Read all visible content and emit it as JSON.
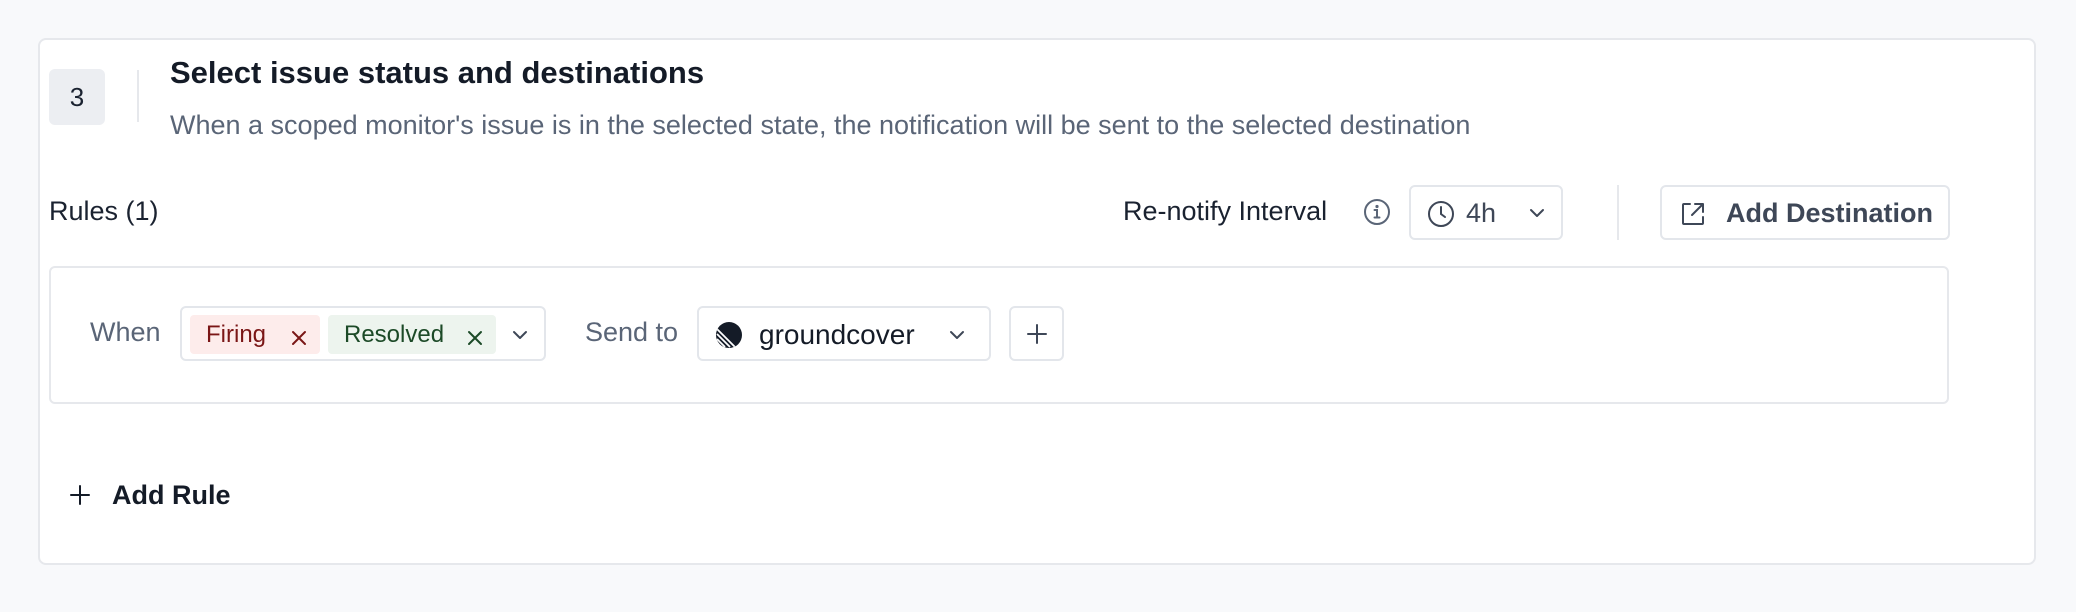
{
  "step": {
    "number": "3",
    "title": "Select issue status and destinations",
    "description": "When a scoped monitor's issue is in the selected state, the notification will be sent to the selected destination"
  },
  "rules": {
    "label": "Rules (1)",
    "renotify_label": "Re-notify Interval",
    "interval_value": "4h",
    "add_destination_label": "Add Destination",
    "add_rule_label": "Add Rule"
  },
  "rule": {
    "when_label": "When",
    "statuses": [
      "Firing",
      "Resolved"
    ],
    "send_to_label": "Send to",
    "destination": "groundcover"
  },
  "icons": {
    "info": "info-icon",
    "clock": "clock-icon",
    "chevron": "chevron-down-icon",
    "external": "external-link-icon",
    "remove": "close-icon",
    "logo": "groundcover-logo-icon",
    "plus": "plus-icon"
  },
  "colors": {
    "firing_bg": "#fdeceb",
    "firing_text": "#7a1616",
    "resolved_bg": "#edf4ee",
    "resolved_text": "#1c4a27"
  }
}
